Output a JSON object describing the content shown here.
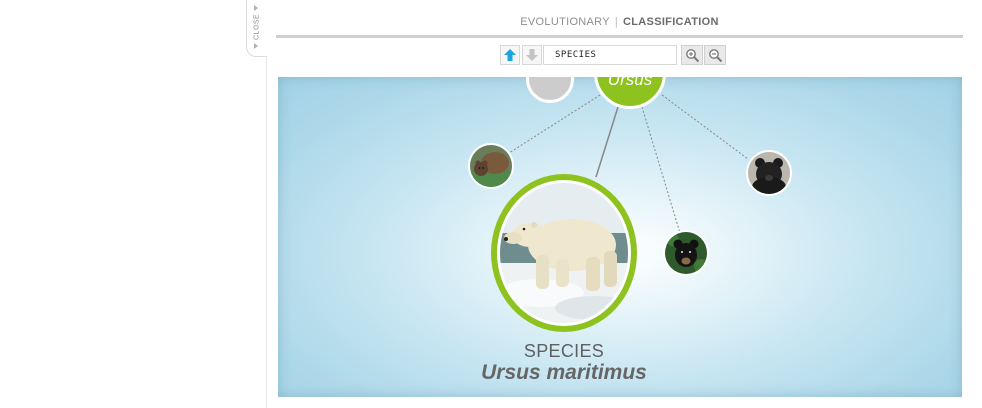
{
  "close_tab": {
    "label": "CLOSE"
  },
  "header": {
    "tab_evolutionary": "EVOLUTIONARY",
    "separator": "|",
    "tab_classification": "CLASSIFICATION"
  },
  "toolbar": {
    "up_icon": "arrow-up-icon",
    "down_icon": "arrow-down-icon",
    "rank_value": "SPECIES",
    "zoom_in_icon": "zoom-in-icon",
    "zoom_out_icon": "zoom-out-icon",
    "accent_color": "#20a4dc"
  },
  "viewer": {
    "parent_node_label": "Ursus",
    "selected_rank": "SPECIES",
    "selected_name": "Ursus maritimus",
    "node_color": "#8dc21f",
    "sibling_nodes": [
      {
        "kind": "brown-bear-thumbnail"
      },
      {
        "kind": "black-bear-thumbnail"
      },
      {
        "kind": "asian-black-bear-thumbnail"
      }
    ]
  }
}
